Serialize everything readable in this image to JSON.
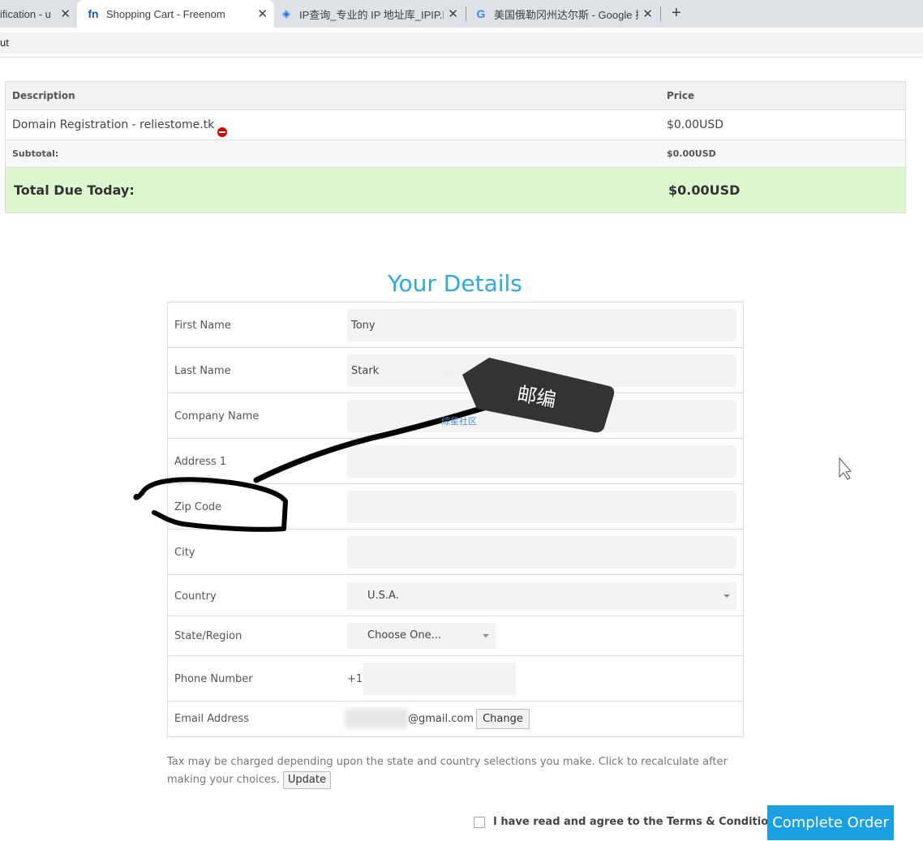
{
  "browser": {
    "tabs": [
      {
        "title": "ification - u",
        "active": false
      },
      {
        "title": "Shopping Cart - Freenom",
        "active": true,
        "favicon": "fn"
      },
      {
        "title": "IP查询_专业的 IP 地址库_IPIP.NE",
        "active": false
      },
      {
        "title": "美国俄勒冈州达尔斯 - Google 搜",
        "active": false
      }
    ],
    "address_fragment": "ut"
  },
  "cart": {
    "headers": {
      "description": "Description",
      "price": "Price"
    },
    "item": {
      "description": "Domain Registration - reliestome.tk",
      "price": "$0.00USD"
    },
    "subtotal": {
      "label": "Subtotal:",
      "value": "$0.00USD"
    },
    "total": {
      "label": "Total Due Today:",
      "value": "$0.00USD"
    }
  },
  "details": {
    "title": "Your Details",
    "fields": {
      "first_name": {
        "label": "First Name",
        "value": "Tony"
      },
      "last_name": {
        "label": "Last Name",
        "value": "Stark"
      },
      "company": {
        "label": "Company Name",
        "value": ""
      },
      "address1": {
        "label": "Address 1",
        "value": ""
      },
      "zip": {
        "label": "Zip Code",
        "value": ""
      },
      "city": {
        "label": "City",
        "value": ""
      },
      "country": {
        "label": "Country",
        "value": "U.S.A."
      },
      "state": {
        "label": "State/Region",
        "value": "Choose One..."
      },
      "phone": {
        "label": "Phone Number",
        "prefix": "+1",
        "value": ""
      },
      "email": {
        "label": "Email Address",
        "value": "@gmail.com",
        "change_label": "Change"
      }
    }
  },
  "tax_note": "Tax may be charged depending upon the state and country selections you make. Click to recalculate after making your choices.",
  "update_label": "Update",
  "agree_label": "I have read and agree to the Terms & Conditions",
  "complete_label": "Complete Order",
  "annotation": {
    "callout_text": "邮编",
    "watermark_text": "综星社区"
  }
}
